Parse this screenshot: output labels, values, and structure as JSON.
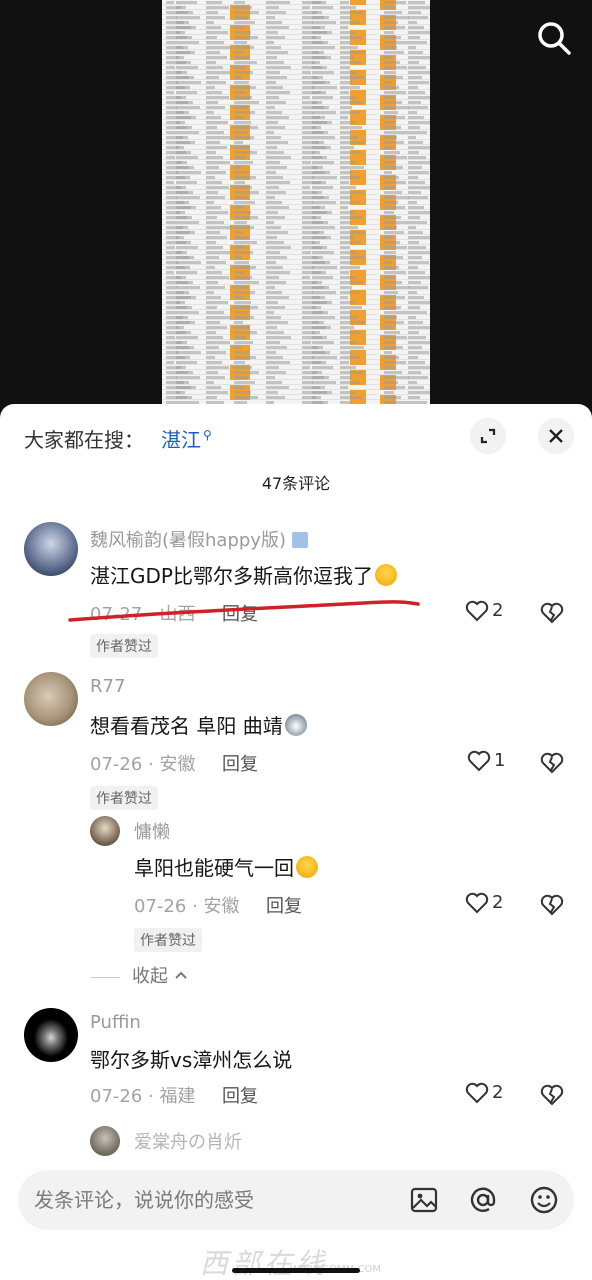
{
  "header": {
    "search_icon": "search-icon"
  },
  "panel": {
    "hot_search_prefix": "大家都在搜：",
    "hot_search_term": "湛江",
    "expand_icon": "expand-icon",
    "close_icon": "close-icon",
    "comment_count": "47条评论"
  },
  "comments": [
    {
      "username": "魏风榆韵(暑假happy版)",
      "text": "湛江GDP比鄂尔多斯高你逗我了",
      "date_location": "07-27 · 山西",
      "reply_label": "回复",
      "likes": "2",
      "badge": "作者赞过"
    },
    {
      "username": "R77",
      "text": "想看看茂名 阜阳 曲靖",
      "date_location": "07-26 · 安徽",
      "reply_label": "回复",
      "likes": "1",
      "badge": "作者赞过",
      "replies": [
        {
          "username": "慵懒",
          "text": "阜阳也能硬气一回",
          "date_location": "07-26 · 安徽",
          "reply_label": "回复",
          "likes": "2",
          "badge": "作者赞过"
        }
      ],
      "collapse_label": "收起"
    },
    {
      "username": "Puffin",
      "text": "鄂尔多斯vs漳州怎么说",
      "date_location": "07-26 · 福建",
      "reply_label": "回复",
      "likes": "2"
    },
    {
      "username": "爱棠舟の肖炘"
    }
  ],
  "input": {
    "placeholder": "发条评论，说说你的感受",
    "icons": [
      "image-icon",
      "at-icon",
      "emoji-icon"
    ]
  },
  "watermark": {
    "text": "西部在线",
    "url": "WWW.GDMM.COM"
  },
  "colors": {
    "accent_link": "#1d5fb8",
    "underline_red": "#d0202a",
    "sheet_orange": "#f0a030"
  }
}
